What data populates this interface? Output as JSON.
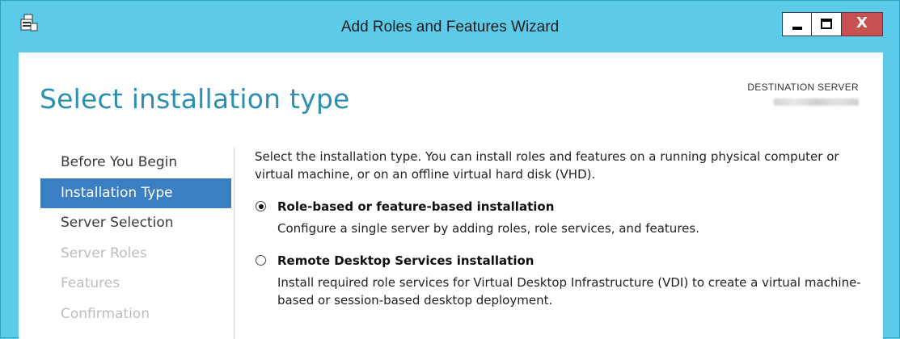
{
  "window": {
    "title": "Add Roles and Features Wizard",
    "title_bar_color": "#5ccbea",
    "close_button_color": "#c75050",
    "close_glyph": "X"
  },
  "header": {
    "page_title": "Select installation type",
    "destination_label": "DESTINATION SERVER"
  },
  "nav": {
    "items": [
      {
        "label": "Before You Begin",
        "state": "normal"
      },
      {
        "label": "Installation Type",
        "state": "active"
      },
      {
        "label": "Server Selection",
        "state": "normal"
      },
      {
        "label": "Server Roles",
        "state": "disabled"
      },
      {
        "label": "Features",
        "state": "disabled"
      },
      {
        "label": "Confirmation",
        "state": "disabled"
      }
    ],
    "active_color": "#3a7fc3"
  },
  "main": {
    "intro": "Select the installation type. You can install roles and features on a running physical computer or virtual machine, or on an offline virtual hard disk (VHD).",
    "options": [
      {
        "label": "Role-based or feature-based installation",
        "description": "Configure a single server by adding roles, role services, and features.",
        "selected": true
      },
      {
        "label": "Remote Desktop Services installation",
        "description": "Install required role services for Virtual Desktop Infrastructure (VDI) to create a virtual machine-based or session-based desktop deployment.",
        "selected": false
      }
    ]
  },
  "icons": {
    "app": "server-manager-icon",
    "minimize": "minimize-icon",
    "maximize": "maximize-icon",
    "close": "close-icon"
  }
}
